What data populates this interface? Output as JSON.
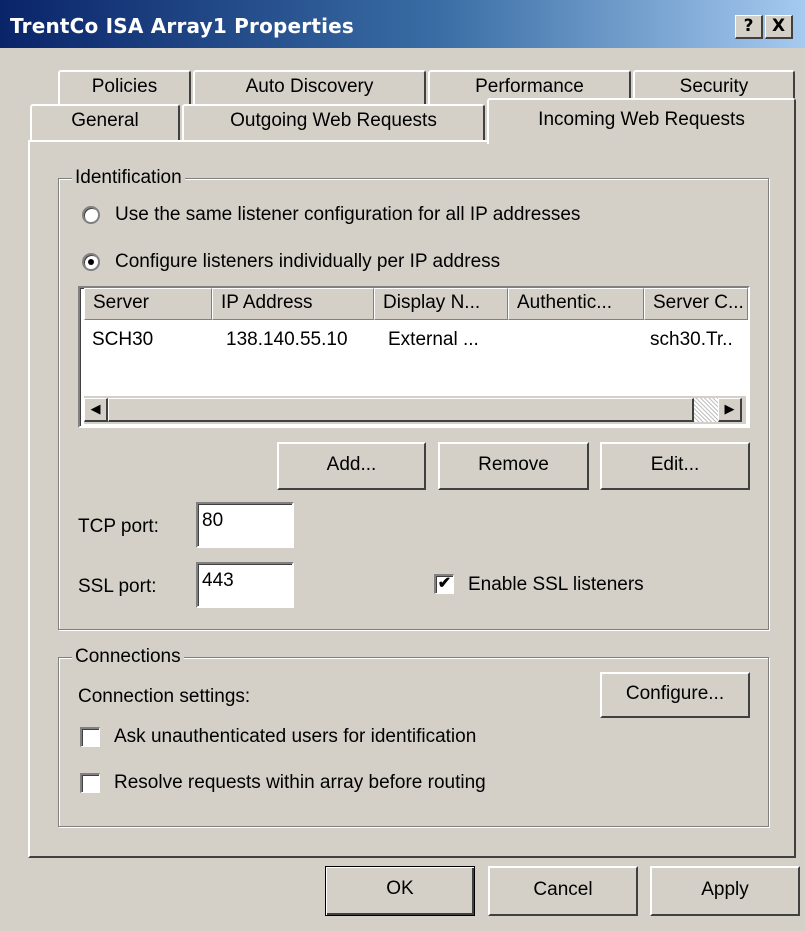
{
  "window": {
    "title": "TrentCo ISA Array1 Properties",
    "help_label": "?",
    "close_label": "X"
  },
  "tabs": {
    "row1": [
      "Policies",
      "Auto Discovery",
      "Performance",
      "Security"
    ],
    "row2": [
      "General",
      "Outgoing Web Requests",
      "Incoming Web Requests"
    ],
    "active": "Incoming Web Requests"
  },
  "identification": {
    "legend": "Identification",
    "radio_same": {
      "label": "Use the same listener configuration for all IP addresses",
      "selected": false
    },
    "radio_individual": {
      "label": "Configure listeners individually per IP address",
      "selected": true
    },
    "table": {
      "columns": [
        "Server",
        "IP Address",
        "Display N...",
        "Authentic...",
        "Server C..."
      ],
      "rows": [
        [
          "SCH30",
          "138.140.55.10",
          "External ...",
          "",
          "sch30.Tr.."
        ]
      ]
    },
    "buttons": {
      "add": "Add...",
      "remove": "Remove",
      "edit": "Edit..."
    },
    "tcp_port": {
      "label": "TCP port:",
      "value": "80"
    },
    "ssl_port": {
      "label": "SSL port:",
      "value": "443"
    },
    "enable_ssl": {
      "label": "Enable SSL listeners",
      "checked": true,
      "mark": "✔"
    }
  },
  "connections": {
    "legend": "Connections",
    "settings_label": "Connection settings:",
    "configure_button": "Configure...",
    "ask_unauth": {
      "label": "Ask unauthenticated users for identification",
      "checked": false
    },
    "resolve_requests": {
      "label": "Resolve requests within array before routing",
      "checked": false
    }
  },
  "footer": {
    "ok": "OK",
    "cancel": "Cancel",
    "apply": "Apply"
  },
  "colors": {
    "titlebar_start": "#0a246a",
    "titlebar_end": "#a6caf0",
    "face": "#d4d0c8"
  }
}
